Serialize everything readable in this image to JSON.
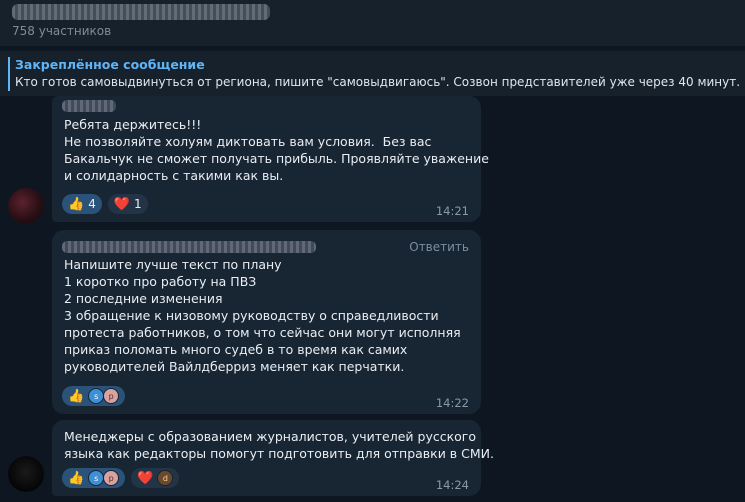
{
  "header": {
    "members": "758 участников"
  },
  "pinned": {
    "title": "Закреплённое сообщение",
    "text": "Кто готов самовыдвинуться от региона, пишите \"самовыдвигаюсь\". Созвон представителей уже через 40 минут."
  },
  "messages": [
    {
      "text": "Ребята держитесь!!!\nНе позволяйте холуям диктовать вам условия.  Без вас\nБакальчук не сможет получать прибыль. Проявляйте уважение\nи солидарность с такими как вы.",
      "time": "14:21",
      "reactions": [
        {
          "emoji": "👍",
          "count": "4"
        },
        {
          "emoji": "❤️",
          "count": "1"
        }
      ]
    },
    {
      "reply_label": "Ответить",
      "text": "Напишите лучше текст по плану\n1 коротко про работу на ПВЗ\n2 последние изменения\n3 обращение к низовому руководству о справедливости\nпротеста работников, о том что сейчас они могут исполняя\nприказ поломать много судеб в то время как самих\nруководителей Вайлдберриз меняет как перчатки.",
      "time": "14:22",
      "reactions": [
        {
          "emoji": "👍",
          "avatars": [
            "s",
            "p"
          ]
        }
      ]
    },
    {
      "text": "Менеджеры с образованием журналистов, учителей русского\nязыка как редакторы помогут подготовить для отправки в СМИ.",
      "time": "14:24",
      "reactions": [
        {
          "emoji": "👍",
          "avatars": [
            "s",
            "p"
          ]
        },
        {
          "emoji": "❤️",
          "avatars": [
            "d"
          ]
        }
      ]
    }
  ],
  "colors": {
    "background": "#0e1621",
    "bubble": "#182533",
    "accent": "#5eb5f7",
    "reaction_active": "#2b5278"
  }
}
